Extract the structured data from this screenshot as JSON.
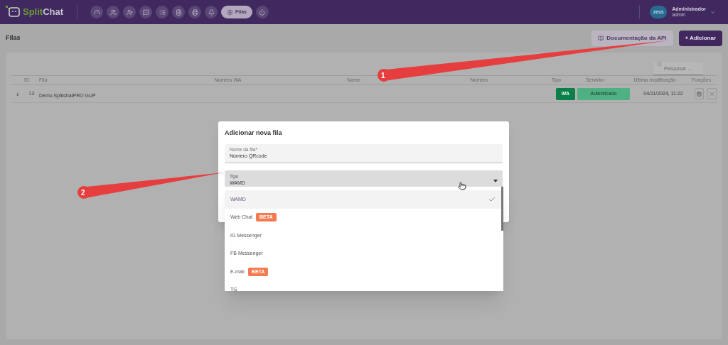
{
  "header": {
    "logo": {
      "part1": "Split",
      "part2": "Chat"
    },
    "nav": [
      {
        "selected": false
      },
      {
        "selected": false
      },
      {
        "selected": false
      },
      {
        "selected": false
      },
      {
        "selected": false
      },
      {
        "selected": false
      },
      {
        "selected": false
      },
      {
        "selected": false
      },
      {
        "label": "Filas",
        "selected": true
      },
      {
        "selected": false
      }
    ],
    "user": {
      "avatar": "zeus",
      "name": "Administrador",
      "role": "admin"
    }
  },
  "page": {
    "title": "Filas",
    "buttons": [
      {
        "kind": "secondary",
        "label": "Documentação da API"
      },
      {
        "kind": "primary",
        "label": "+ Adicionar"
      }
    ]
  },
  "search": {
    "placeholder": "Pesquisar ..."
  },
  "table": {
    "columns": [
      "ID",
      "Fila",
      "Número WA",
      "Nome",
      "Número",
      "Tipo",
      "Servidor",
      "Última modificação",
      "Funções"
    ],
    "rows": [
      {
        "expand": "›",
        "id": "13",
        "fila": "Demo SplitchatPRO GUP",
        "tipo": "WA",
        "servidor": "Autenticado",
        "modified": "04/11/2024, 11:22"
      }
    ]
  },
  "dialog": {
    "title": "Adicionar nova fila",
    "name_field": {
      "label": "Nome da fila*",
      "value": "Número QRcode"
    },
    "type_field": {
      "label": "Tipo",
      "value": "WAMD"
    },
    "options": [
      {
        "label": "WAMD",
        "selected": true
      },
      {
        "label": "Web Chat",
        "badge": "BETA",
        "selected": false
      },
      {
        "label": "IG Messenger",
        "selected": false
      },
      {
        "label": "FB Messenger",
        "selected": false
      },
      {
        "label": "E-mail",
        "badge": "BETA",
        "selected": false
      },
      {
        "label": "TG",
        "selected": false
      }
    ]
  },
  "annotations": [
    "1",
    "2"
  ]
}
